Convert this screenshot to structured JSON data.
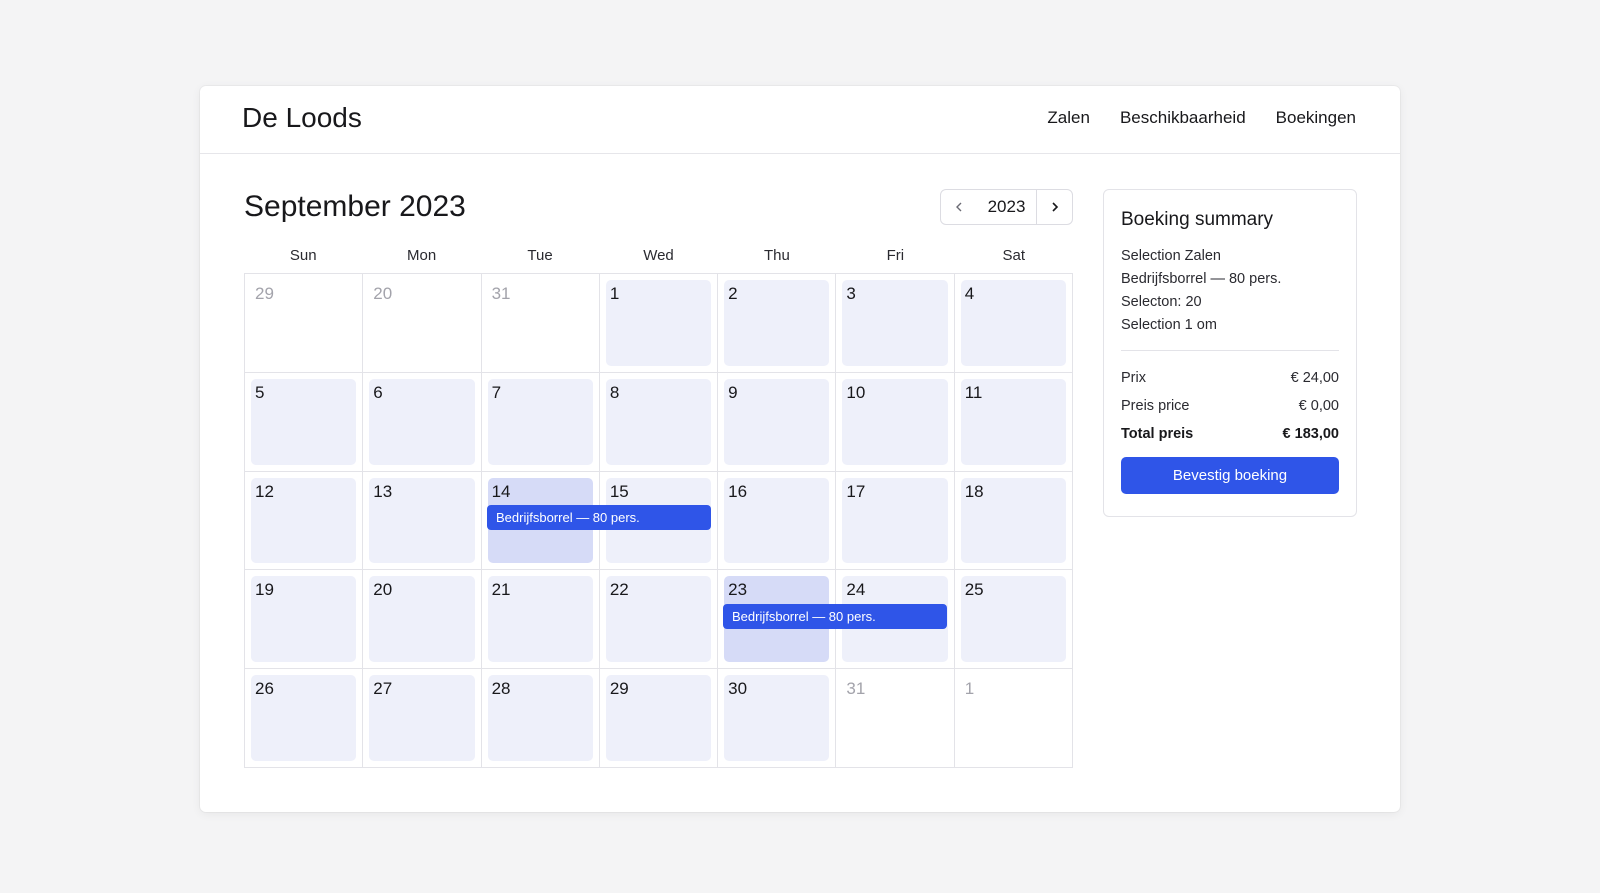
{
  "app": {
    "brand": "De Loods"
  },
  "nav": {
    "items": [
      {
        "label": "Zalen"
      },
      {
        "label": "Beschikbaarheid"
      },
      {
        "label": "Boekingen"
      }
    ]
  },
  "calendar": {
    "month_title": "September 2023",
    "year": "2023",
    "weekdays": [
      "Sun",
      "Mon",
      "Tue",
      "Wed",
      "Thu",
      "Fri",
      "Sat"
    ],
    "days": [
      {
        "label": "29",
        "out": true
      },
      {
        "label": "20",
        "out": true
      },
      {
        "label": "31",
        "out": true
      },
      {
        "label": "1"
      },
      {
        "label": "2"
      },
      {
        "label": "3"
      },
      {
        "label": "4"
      },
      {
        "label": "5"
      },
      {
        "label": "6"
      },
      {
        "label": "7"
      },
      {
        "label": "8"
      },
      {
        "label": "9"
      },
      {
        "label": "10"
      },
      {
        "label": "11"
      },
      {
        "label": "12"
      },
      {
        "label": "13"
      },
      {
        "label": "14",
        "selected": true
      },
      {
        "label": "15"
      },
      {
        "label": "16"
      },
      {
        "label": "17"
      },
      {
        "label": "18"
      },
      {
        "label": "19"
      },
      {
        "label": "20"
      },
      {
        "label": "21"
      },
      {
        "label": "22"
      },
      {
        "label": "23",
        "selected": true
      },
      {
        "label": "24"
      },
      {
        "label": "25"
      },
      {
        "label": "26"
      },
      {
        "label": "27"
      },
      {
        "label": "28"
      },
      {
        "label": "29"
      },
      {
        "label": "30"
      },
      {
        "label": "31",
        "out": true
      },
      {
        "label": "1",
        "out": true
      }
    ],
    "events": [
      {
        "label": "Bedrijfsborrel — 80 pers.",
        "start_day": "14"
      },
      {
        "label": "Bedrijfsborrel — 80 pers.",
        "start_day": "23"
      }
    ]
  },
  "summary": {
    "title": "Boeking summary",
    "lines": [
      "Selection Zalen",
      "Bedrijfsborrel — 80 pers.",
      "Selecton: 20",
      "Selection 1 om"
    ],
    "prices": [
      {
        "label": "Prix",
        "value": "€ 24,00"
      },
      {
        "label": "Preis price",
        "value": "€ 0,00"
      },
      {
        "label": "Total preis",
        "value": "€ 183,00"
      }
    ],
    "confirm_label": "Bevestig boeking"
  },
  "colors": {
    "accent": "#2f55e8",
    "cell": "#eef0fa",
    "cell_selected": "#d6dbf7",
    "background": "#f4f4f5"
  },
  "icons": {
    "prev": "chevron-left-icon",
    "next": "chevron-right-icon"
  }
}
